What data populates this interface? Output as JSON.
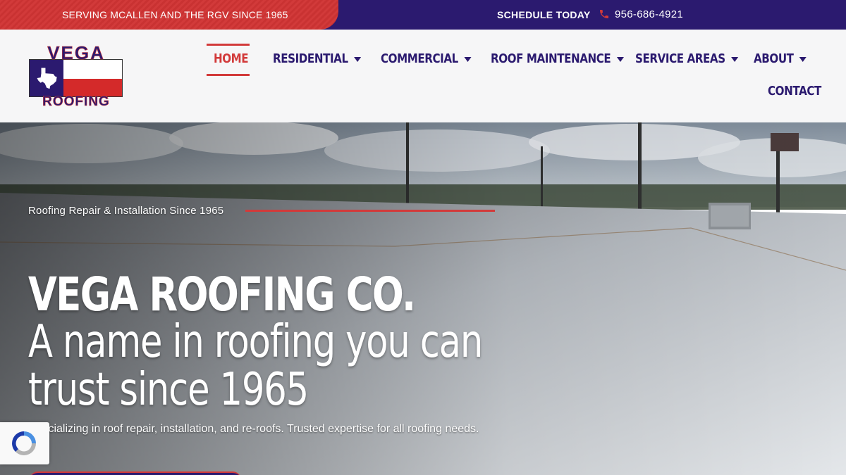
{
  "topbar": {
    "tagline": "SERVING MCALLEN AND THE RGV SINCE 1965",
    "schedule_label": "SCHEDULE TODAY",
    "phone_icon": "phone-icon",
    "phone": "956-686-4921"
  },
  "logo": {
    "top_text": "VEGA",
    "bottom_text": "ROOFING"
  },
  "nav": {
    "items": [
      {
        "label": "HOME",
        "active": true
      },
      {
        "label": "RESIDENTIAL",
        "dropdown": true
      },
      {
        "label": "COMMERCIAL",
        "dropdown": true
      },
      {
        "label": "ROOF MAINTENANCE",
        "dropdown": true
      },
      {
        "label": "SERVICE AREAS",
        "dropdown": true
      },
      {
        "label": "ABOUT",
        "dropdown": true
      },
      {
        "label": "CONTACT"
      }
    ]
  },
  "hero": {
    "subtitle": "Roofing Repair & Installation Since 1965",
    "title": "VEGA ROOFING CO.",
    "tagline": "A name in roofing you can trust since 1965",
    "description": "Specializing in roof repair, installation, and re-roofs. Trusted expertise for all roofing needs."
  },
  "colors": {
    "brand_navy": "#2b1a6f",
    "brand_red": "#d23a3a"
  }
}
